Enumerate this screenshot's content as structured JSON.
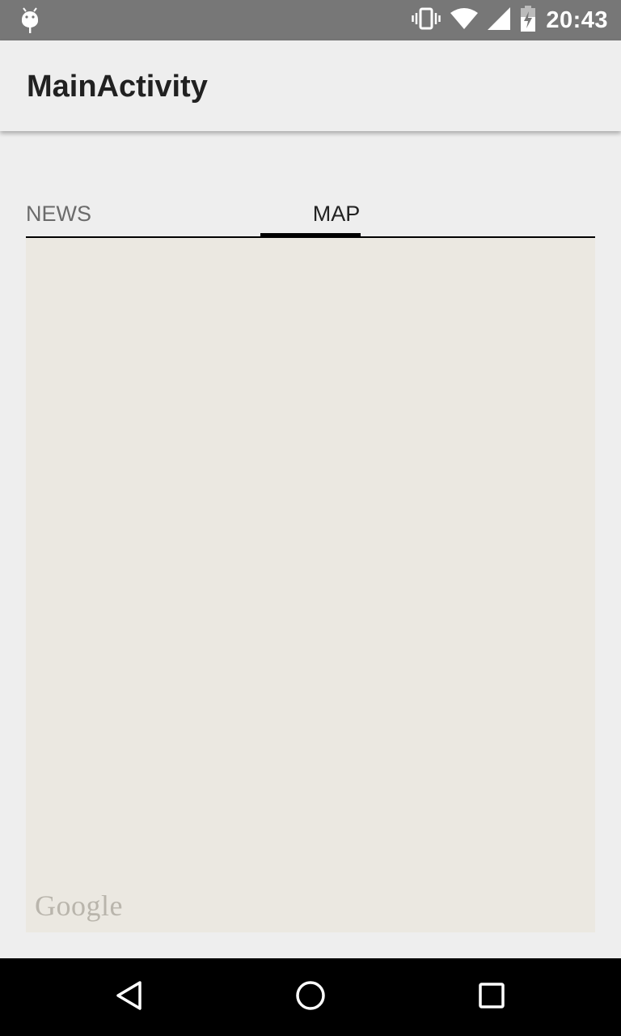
{
  "status_bar": {
    "time": "20:43",
    "icons": [
      "android-debug-icon",
      "vibrate-icon",
      "wifi-icon",
      "signal-icon",
      "battery-charging-icon"
    ]
  },
  "app_bar": {
    "title": "MainActivity"
  },
  "tabs": [
    {
      "label": "NEWS",
      "selected": false
    },
    {
      "label": "MAP",
      "selected": true
    }
  ],
  "map": {
    "background_color": "#ebe8e1",
    "attribution": "Google"
  },
  "nav_bar": {
    "buttons": [
      "back-icon",
      "home-icon",
      "recents-icon"
    ]
  },
  "colors": {
    "status_bar": "#777777",
    "app_bar": "#eeeeee",
    "tab_indicator": "#000000",
    "nav_bar": "#000000"
  }
}
